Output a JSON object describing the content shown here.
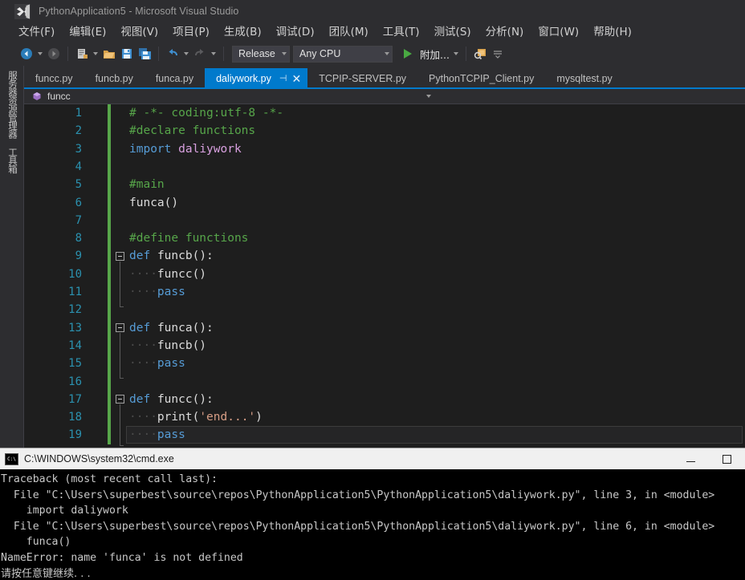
{
  "window": {
    "title": "PythonApplication5 - Microsoft Visual Studio",
    "logo_name": "visual-studio-logo"
  },
  "menu": {
    "items": [
      {
        "label": "文件(F)"
      },
      {
        "label": "编辑(E)"
      },
      {
        "label": "视图(V)"
      },
      {
        "label": "项目(P)"
      },
      {
        "label": "生成(B)"
      },
      {
        "label": "调试(D)"
      },
      {
        "label": "团队(M)"
      },
      {
        "label": "工具(T)"
      },
      {
        "label": "测试(S)"
      },
      {
        "label": "分析(N)"
      },
      {
        "label": "窗口(W)"
      },
      {
        "label": "帮助(H)"
      }
    ]
  },
  "toolbar": {
    "configuration": "Release",
    "platform": "Any CPU",
    "attach_label": "附加...",
    "accent": "#007acc",
    "play_color": "#49a942"
  },
  "sidebar": {
    "tabs": [
      {
        "label": "服务器资源管理器"
      },
      {
        "label": "工具箱"
      }
    ]
  },
  "tabs": {
    "items": [
      {
        "label": "funcc.py",
        "active": false
      },
      {
        "label": "funcb.py",
        "active": false
      },
      {
        "label": "funca.py",
        "active": false
      },
      {
        "label": "daliywork.py",
        "active": true
      },
      {
        "label": "TCPIP-SERVER.py",
        "active": false
      },
      {
        "label": "PythonTCPIP_Client.py",
        "active": false
      },
      {
        "label": "mysqltest.py",
        "active": false
      }
    ],
    "pin_glyph": "⊣",
    "close_glyph": "✕"
  },
  "navbar": {
    "member": "funcc"
  },
  "editor": {
    "language": "python",
    "current_line": 19,
    "line_numbers": [
      1,
      2,
      3,
      4,
      5,
      6,
      7,
      8,
      9,
      10,
      11,
      12,
      13,
      14,
      15,
      16,
      17,
      18,
      19
    ],
    "lines": [
      {
        "n": 1,
        "text": "# -*- coding:utf-8 -*-"
      },
      {
        "n": 2,
        "text": "#declare functions"
      },
      {
        "n": 3,
        "text": "import daliywork"
      },
      {
        "n": 4,
        "text": ""
      },
      {
        "n": 5,
        "text": "#main"
      },
      {
        "n": 6,
        "text": "funca()"
      },
      {
        "n": 7,
        "text": ""
      },
      {
        "n": 8,
        "text": "#define functions"
      },
      {
        "n": 9,
        "text": "def funcb():"
      },
      {
        "n": 10,
        "text": "    funcc()"
      },
      {
        "n": 11,
        "text": "    pass"
      },
      {
        "n": 12,
        "text": ""
      },
      {
        "n": 13,
        "text": "def funca():"
      },
      {
        "n": 14,
        "text": "    funcb()"
      },
      {
        "n": 15,
        "text": "    pass"
      },
      {
        "n": 16,
        "text": ""
      },
      {
        "n": 17,
        "text": "def funcc():"
      },
      {
        "n": 18,
        "text": "    print('end...')"
      },
      {
        "n": 19,
        "text": "    pass"
      }
    ],
    "colors": {
      "background": "#1e1e1e",
      "keyword": "#569cd6",
      "comment": "#57a64a",
      "string": "#d69d85",
      "module": "#d8a0df",
      "line_number": "#2b91af",
      "change_bar": "#57a64a"
    }
  },
  "console": {
    "title": "C:\\WINDOWS\\system32\\cmd.exe",
    "icon_name": "cmd-icon",
    "minimize_label": "—",
    "maximize_label": "▢",
    "output": [
      "Traceback (most recent call last):",
      "  File \"C:\\Users\\superbest\\source\\repos\\PythonApplication5\\PythonApplication5\\daliywork.py\", line 3, in <module>",
      "    import daliywork",
      "  File \"C:\\Users\\superbest\\source\\repos\\PythonApplication5\\PythonApplication5\\daliywork.py\", line 6, in <module>",
      "    funca()",
      "NameError: name 'funca' is not defined",
      "请按任意键继续. . ."
    ]
  }
}
